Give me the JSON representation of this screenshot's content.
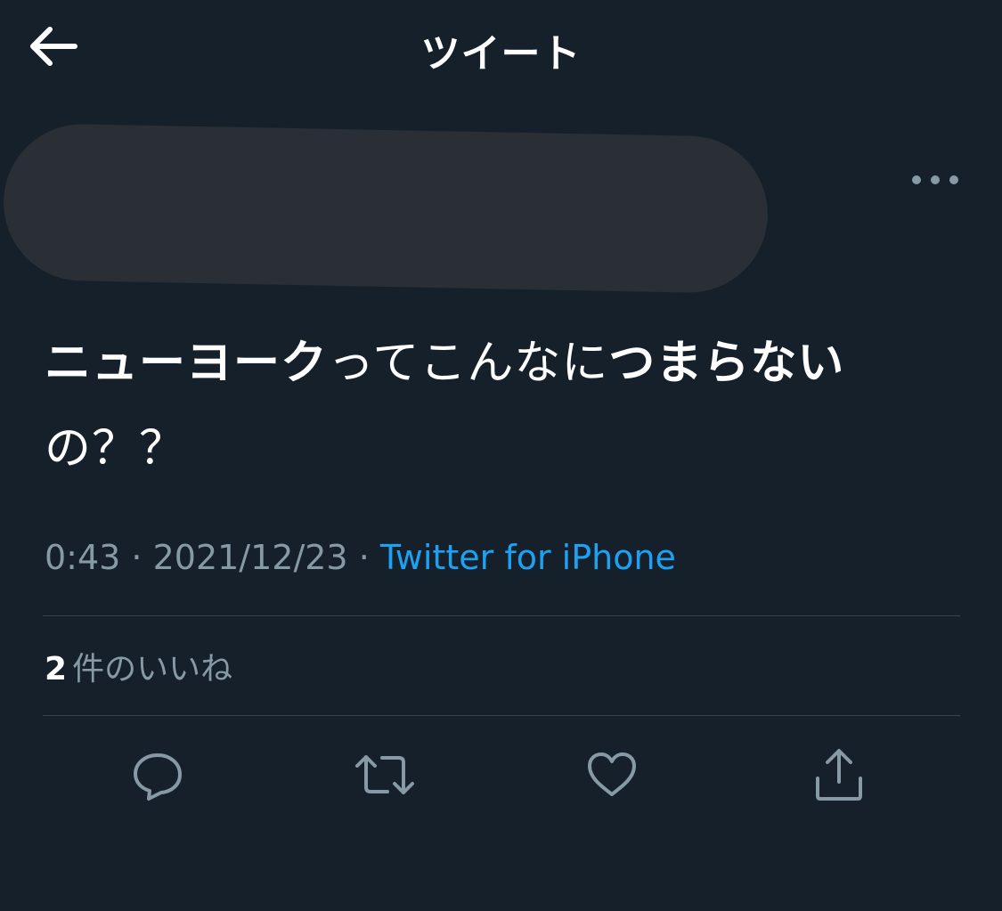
{
  "header": {
    "title": "ツイート",
    "back_icon": "arrow-left-icon"
  },
  "tweet": {
    "text_segments": [
      {
        "text": "ニューヨーク",
        "bold": true
      },
      {
        "text": "ってこんなに",
        "bold": false
      },
      {
        "text": "つまらない",
        "bold": true
      },
      {
        "text": "の？？",
        "bold": false
      }
    ],
    "time": "0:43",
    "separator": " · ",
    "date": "2021/12/23",
    "source": "Twitter for iPhone"
  },
  "stats": {
    "likes_count": "2",
    "likes_label": "件のいいね"
  },
  "actions": [
    "reply-icon",
    "retweet-icon",
    "like-icon",
    "share-icon"
  ],
  "colors": {
    "background": "#15202b",
    "secondary_text": "#8899a6",
    "link": "#1da1f2",
    "divider": "#38444d",
    "redaction": "#292f34"
  }
}
